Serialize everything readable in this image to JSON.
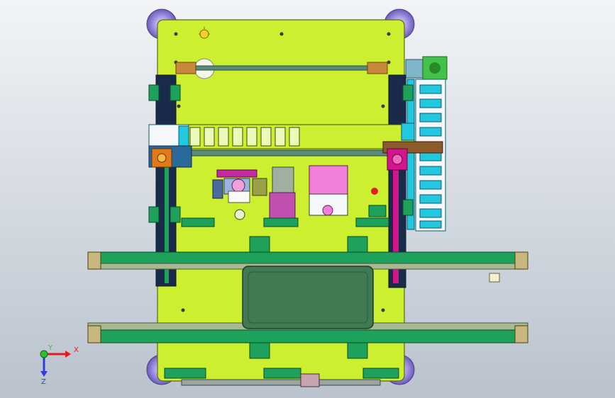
{
  "viewport": {
    "colors": {
      "background_top": "#f2f4f7",
      "background_bottom": "#b9c2cd",
      "base_plate": "#ccf030",
      "rail_green": "#1ea25b",
      "belt_green": "#3f7a52",
      "cable_cyan": "#22c8e0",
      "magenta": "#d4148c",
      "caster_purple": "#8e7bd0",
      "motor_green": "#42c24a"
    }
  },
  "triad": {
    "x_label": "X",
    "y_label": "Y",
    "z_label": "Z",
    "x_color": "#e21b1b",
    "y_color": "#2fbf2f",
    "z_color": "#2a3fd6"
  }
}
